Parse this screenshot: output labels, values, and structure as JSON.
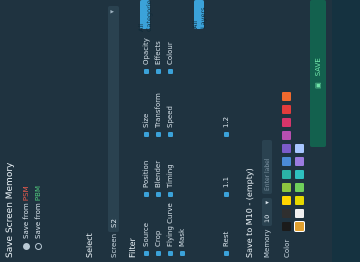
{
  "title": "Save Screen Memory",
  "options": [
    {
      "prefix": "Save from ",
      "source": "PSM",
      "color": "#e45a4d",
      "selected": true
    },
    {
      "prefix": "Save from ",
      "source": "PBM",
      "color": "#4ec27a",
      "selected": false
    }
  ],
  "select": {
    "label": "Select",
    "screen_label": "Screen",
    "screen_value": "S2"
  },
  "filter": {
    "label": "Filter",
    "items": [
      "Source",
      "Crop",
      "Flying Curve",
      "Mask",
      "Position",
      "Blender",
      "Timing",
      "Size",
      "Transform",
      "Speed",
      "Opacity",
      "Effects",
      "Colour"
    ],
    "all_categories": "All Categories",
    "all_layers": "All Layers",
    "rows": {
      "label_a": "Rest",
      "value_a": "1.1",
      "value_b": "1.2"
    }
  },
  "save": {
    "title": "Save to M10 - (empty)",
    "memory_label": "Memory",
    "memory_value": "10",
    "color_label": "Color",
    "input_placeholder": "Enter label",
    "button_label": "SAVE"
  },
  "colors": {
    "selected": "#e0a030",
    "palette": [
      "#1b1b1b",
      "#2f2f2f",
      "#ffd400",
      "#8dc63f",
      "#2bb3a6",
      "#4b8ad6",
      "#7b5bc9",
      "#b64fb0",
      "#d7356a",
      "#e23c3c",
      "#ef6a2e",
      "#e0a030",
      "#f0f0f0",
      "#9a9a9a",
      "#e6d800",
      "#6fcf5b",
      "#2ec0c0",
      "#2e6fdc",
      "#7e5bd6",
      "#c44ec8",
      "#ea3f80",
      "#ff4a4a"
    ]
  }
}
